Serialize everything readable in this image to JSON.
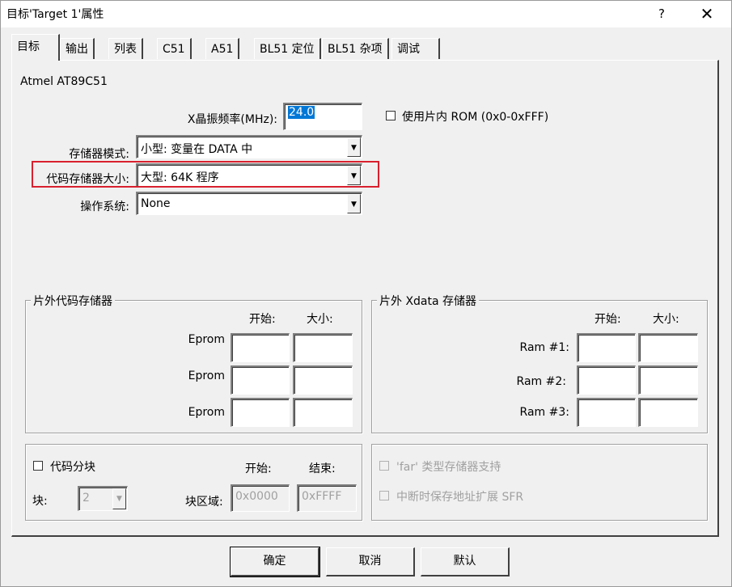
{
  "window": {
    "title": "目标'Target 1'属性",
    "help": "?",
    "close": "✕"
  },
  "tabs": [
    {
      "label": "目标",
      "active": true
    },
    {
      "label": "输出"
    },
    {
      "label": "列表"
    },
    {
      "label": "C51"
    },
    {
      "label": "A51"
    },
    {
      "label": "BL51 定位"
    },
    {
      "label": "BL51 杂项"
    },
    {
      "label": "调试"
    }
  ],
  "target": {
    "device": "Atmel AT89C51",
    "xtal_label": "X晶振频率(MHz):",
    "xtal_value": "24.0",
    "use_onchip_rom_label": "使用片内 ROM (0x0-0xFFF)",
    "memory_model_label": "存储器模式:",
    "memory_model_value": "小型: 变量在 DATA 中",
    "code_rom_size_label": "代码存储器大小:",
    "code_rom_size_value": "大型: 64K 程序",
    "os_label": "操作系统:",
    "os_value": "None"
  },
  "offchip_code": {
    "title": "片外代码存储器",
    "start_header": "开始:",
    "size_header": "大小:",
    "rows": [
      {
        "label": "Eprom",
        "start": "",
        "size": ""
      },
      {
        "label": "Eprom",
        "start": "",
        "size": ""
      },
      {
        "label": "Eprom",
        "start": "",
        "size": ""
      }
    ]
  },
  "offchip_xdata": {
    "title": "片外 Xdata 存储器",
    "start_header": "开始:",
    "size_header": "大小:",
    "rows": [
      {
        "label": "Ram #1:",
        "start": "",
        "size": ""
      },
      {
        "label": "Ram #2:",
        "start": "",
        "size": ""
      },
      {
        "label": "Ram #3:",
        "start": "",
        "size": ""
      }
    ]
  },
  "code_banking": {
    "checkbox_label": "代码分块",
    "start_header": "开始:",
    "end_header": "结束:",
    "banks_label": "块:",
    "banks_value": "2",
    "bank_area_label": "块区域:",
    "bank_area_start": "0x0000",
    "bank_area_end": "0xFFFF"
  },
  "options": {
    "far_memory_label": "'far' 类型存储器支持",
    "save_sfr_label": "中断时保存地址扩展 SFR"
  },
  "buttons": {
    "ok": "确定",
    "cancel": "取消",
    "defaults": "默认"
  },
  "colors": {
    "highlight_box": "#d9202e",
    "selection": "#0078d7"
  }
}
